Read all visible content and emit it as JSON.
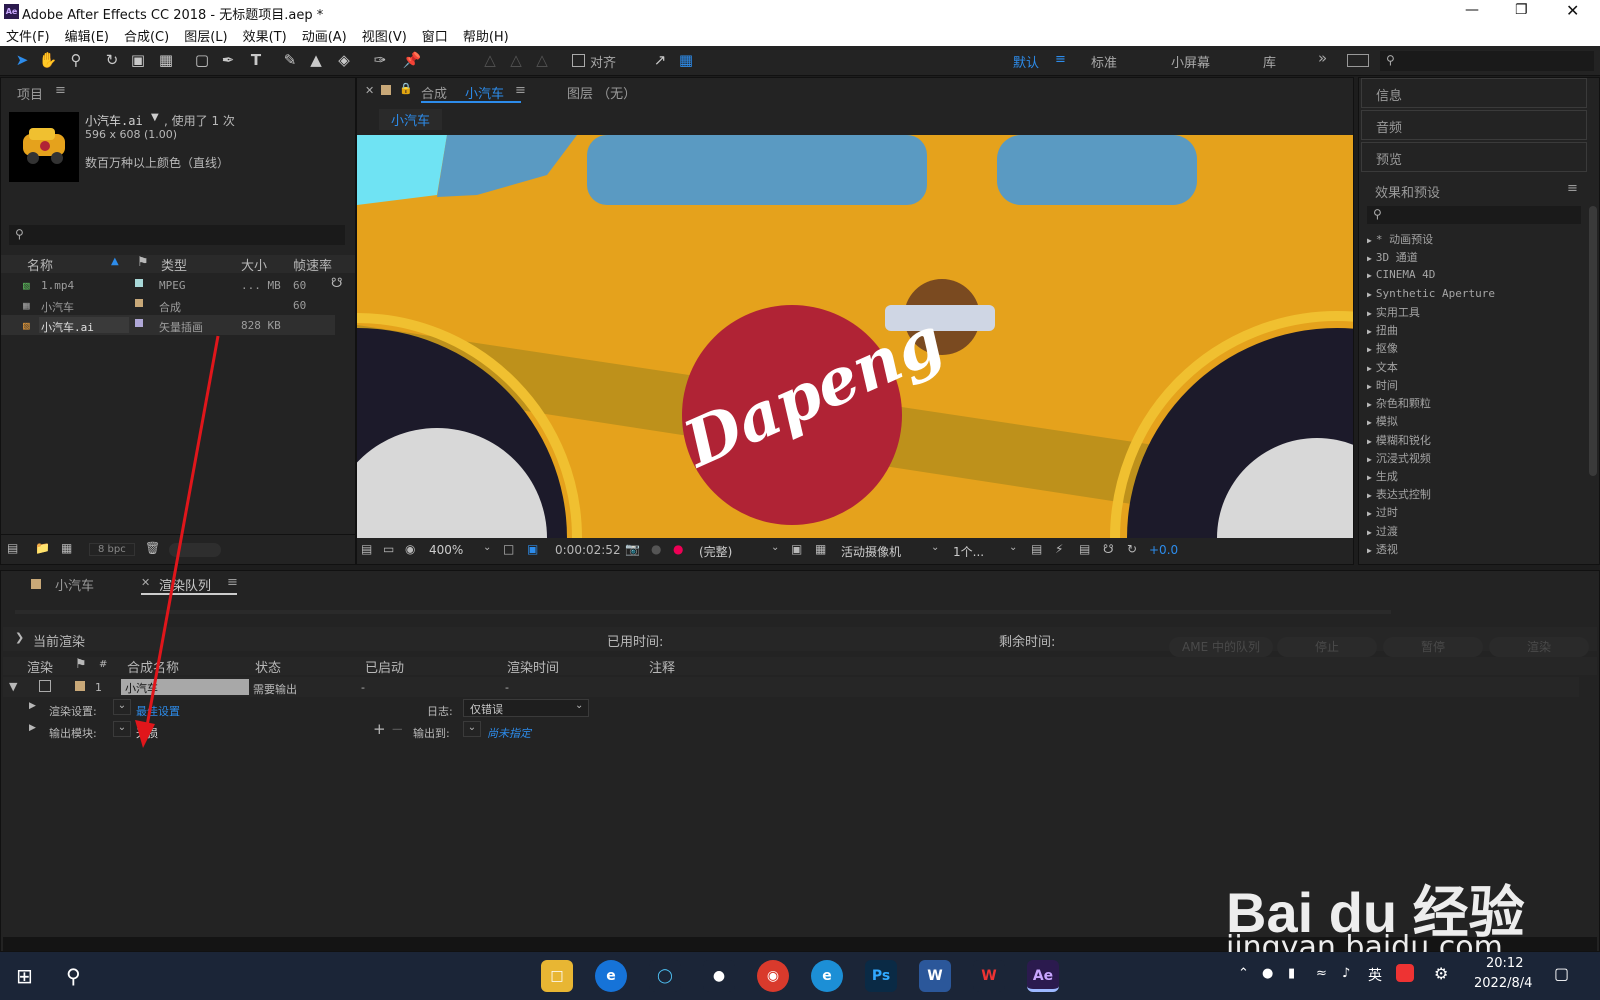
{
  "title": "Adobe After Effects CC 2018 - 无标题项目.aep *",
  "menu": [
    "文件(F)",
    "编辑(E)",
    "合成(C)",
    "图层(L)",
    "效果(T)",
    "动画(A)",
    "视图(V)",
    "窗口",
    "帮助(H)"
  ],
  "toolbar": {
    "align": "对齐"
  },
  "workspaces": {
    "default": "默认",
    "standard": "标准",
    "small": "小屏幕",
    "library": "库"
  },
  "project": {
    "title": "项目",
    "item_name": "小汽车.ai",
    "used": ", 使用了 1 次",
    "dims": "596 x 608 (1.00)",
    "colors": "数百万种以上颜色（直线）",
    "columns": [
      "名称",
      "类型",
      "大小",
      "帧速率"
    ],
    "items": [
      {
        "name": "1.mp4",
        "type": "MPEG",
        "size": "... MB",
        "fps": "60",
        "color": "#a8d8d8"
      },
      {
        "name": "小汽车",
        "type": "合成",
        "size": "",
        "fps": "60",
        "color": "#c8a878"
      },
      {
        "name": "小汽车.ai",
        "type": "矢量插画",
        "size": "828 KB",
        "fps": "",
        "color": "#b0a8d8"
      }
    ],
    "bpc": "8 bpc"
  },
  "comp": {
    "tab_prefix": "合成",
    "tab_name": "小汽车",
    "layer_tab": "图层 （无）",
    "breadcrumb": "小汽车",
    "zoom": "400%",
    "timecode": "0:00:02:52",
    "resolution": "(完整)",
    "camera": "活动摄像机",
    "views": "1个...",
    "exposure": "+0.0",
    "car_text": "Dapeng"
  },
  "right_panels": {
    "info": "信息",
    "audio": "音频",
    "preview": "预览",
    "effects": "效果和预设",
    "effects_list": [
      "* 动画预设",
      "3D 通道",
      "CINEMA 4D",
      "Synthetic Aperture",
      "实用工具",
      "扭曲",
      "抠像",
      "文本",
      "时间",
      "杂色和颗粒",
      "模拟",
      "模糊和锐化",
      "沉浸式视频",
      "生成",
      "表达式控制",
      "过时",
      "过渡",
      "透视"
    ]
  },
  "bottom": {
    "tab_comp": "小汽车",
    "tab_render": "渲染队列",
    "current_render": "当前渲染",
    "elapsed": "已用时间:",
    "remaining": "剩余时间:",
    "buttons": [
      "AME 中的队列",
      "停止",
      "暂停",
      "渲染"
    ],
    "columns": [
      "渲染",
      "#",
      "合成名称",
      "状态",
      "已启动",
      "渲染时间",
      "注释"
    ],
    "item": {
      "num": "1",
      "name": "小汽车",
      "status": "需要输出",
      "started": "-",
      "time": "-"
    },
    "render_settings_label": "渲染设置:",
    "render_settings_value": "最佳设置",
    "log_label": "日志:",
    "log_value": "仅错误",
    "output_module_label": "输出模块:",
    "output_module_value": "无损",
    "output_to_label": "输出到:",
    "output_to_value": "尚未指定"
  },
  "watermark": {
    "brand": "Bai du 经验",
    "url": "jingyan.baidu.com"
  },
  "taskbar": {
    "time": "20:12",
    "date": "2022/8/4",
    "ime": "英"
  },
  "colors": {
    "accent": "#2d8ceb",
    "arrow": "#e0161b",
    "car_yellow": "#e5a21c",
    "car_red": "#b02335"
  }
}
